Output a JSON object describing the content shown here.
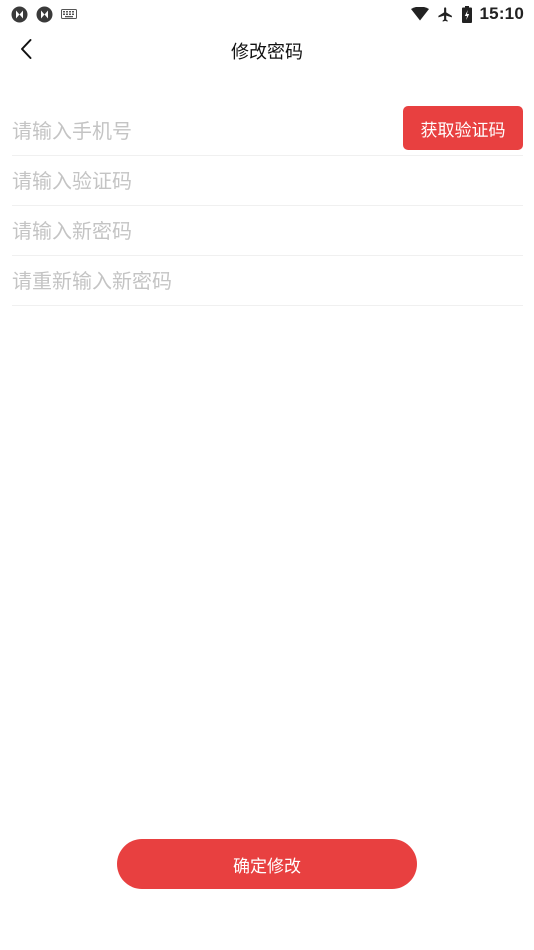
{
  "status_bar": {
    "time": "15:10",
    "icons": [
      "sync-icon",
      "sync-icon",
      "keyboard-icon",
      "wifi-icon",
      "airplane-icon",
      "battery-charging-icon"
    ]
  },
  "header": {
    "back_icon": "chevron-left-icon",
    "title": "修改密码"
  },
  "form": {
    "phone": {
      "value": "",
      "placeholder": "请输入手机号"
    },
    "get_code_label": "获取验证码",
    "code": {
      "value": "",
      "placeholder": "请输入验证码"
    },
    "new_password": {
      "value": "",
      "placeholder": "请输入新密码"
    },
    "confirm_password": {
      "value": "",
      "placeholder": "请重新输入新密码"
    }
  },
  "footer": {
    "confirm_label": "确定修改"
  },
  "colors": {
    "accent": "#e84040",
    "placeholder": "#c4c4c4",
    "divider": "#f0f0f0"
  }
}
